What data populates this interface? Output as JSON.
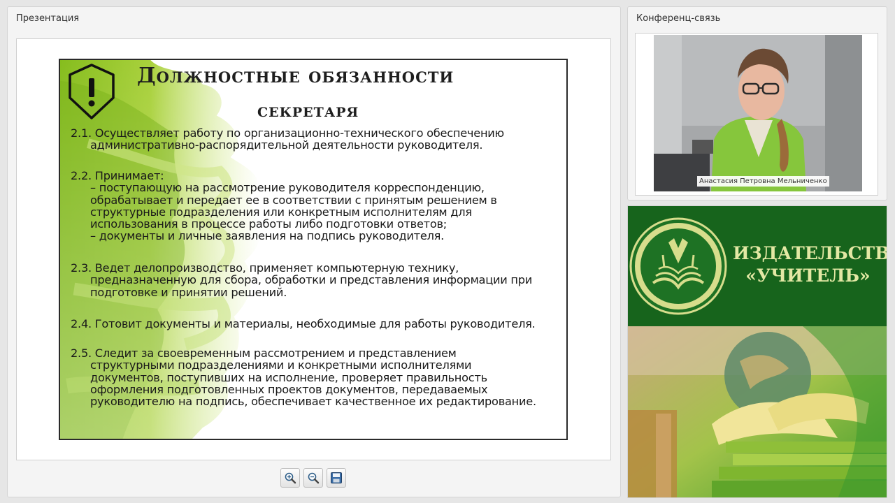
{
  "presentation": {
    "title": "Презентация",
    "slide": {
      "title_line1": "Должностные обязанности",
      "title_line2": "секретаря",
      "duties": [
        {
          "lines": [
            "2.1. Осуществляет работу по организационно-технического обеспечению",
            "административно-распорядительной деятельности руководителя."
          ]
        },
        {
          "lines": [
            "2.2. Принимает:",
            "– поступающую на рассмотрение руководителя корреспонденцию,",
            "обрабатывает и передает ее в соответствии с принятым решением в",
            "структурные подразделения или конкретным исполнителям для",
            "использования в процессе работы либо подготовки ответов;",
            "– документы и личные заявления на подпись руководителя."
          ]
        },
        {
          "lines": [
            "2.3. Ведет делопроизводство, применяет компьютерную технику,",
            "предназначенную для сбора, обработки и представления информации при",
            "подготовке и принятии решений."
          ]
        },
        {
          "lines": [
            "2.4. Готовит документы и материалы, необходимые для работы руководителя."
          ]
        },
        {
          "lines": [
            "2.5. Следит за своевременным рассмотрением и представлением",
            "структурными подразделениями и конкретными исполнителями",
            "документов, поступивших на исполнение, проверяет правильность",
            "оформления подготовленных проектов документов, передаваемых",
            "руководителю на подпись, обеспечивает качественное их редактирование."
          ]
        }
      ]
    },
    "toolbar": {
      "zoom_in_icon": "zoom-in-icon",
      "zoom_out_icon": "zoom-out-icon",
      "save_icon": "floppy-disk-icon"
    }
  },
  "conference": {
    "title": "Конференц-связь",
    "speaker_name": "Анастасия Петровна Мельниченко"
  },
  "publisher": {
    "name_line1": "ИЗДАТЕЛЬСТВО",
    "name_line2": "«УЧИТЕЛЬ»"
  },
  "colors": {
    "slide_accent": "#8cc21f",
    "publisher_green": "#17641c",
    "publisher_text": "#e3e8a4"
  }
}
